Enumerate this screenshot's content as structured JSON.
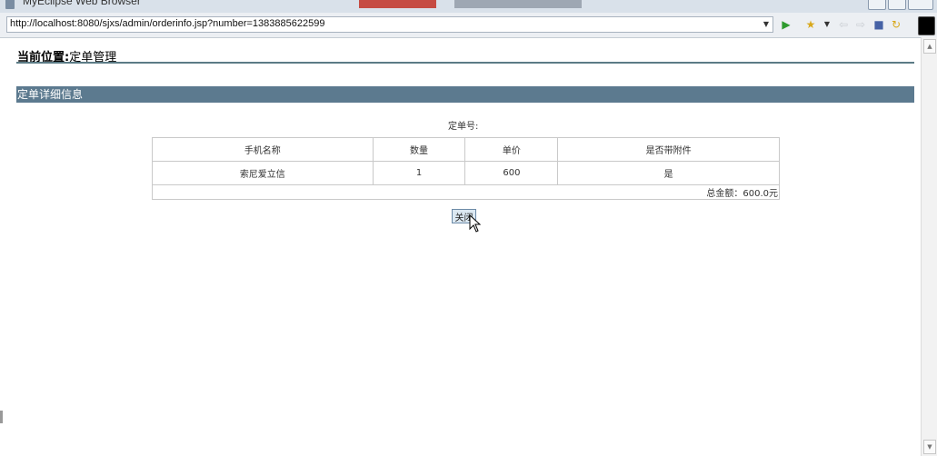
{
  "window": {
    "title": "MyEclipse Web Browser"
  },
  "browser": {
    "url": "http://localhost:8080/sjxs/admin/orderinfo.jsp?number=1383885622599"
  },
  "page": {
    "location_label": "当前位置:",
    "location_value": "定单管理",
    "section_title": "定单详细信息",
    "order_number_label": "定单号:",
    "table": {
      "headers": [
        "手机名称",
        "数量",
        "单价",
        "是否带附件"
      ],
      "rows": [
        [
          "索尼爱立信",
          "1",
          "600",
          "是"
        ]
      ],
      "total": "总金额：600.0元"
    },
    "close_label": "关闭"
  },
  "icons": {
    "go": "play-icon",
    "favorites": "star-icon",
    "back": "back-arrow-icon",
    "forward": "forward-arrow-icon",
    "stop": "stop-icon",
    "refresh": "refresh-icon"
  },
  "colors": {
    "section_bar": "#5c7a8f",
    "rule": "#5b7b86",
    "go": "#2e9b2e",
    "favorites": "#d8a81b"
  }
}
